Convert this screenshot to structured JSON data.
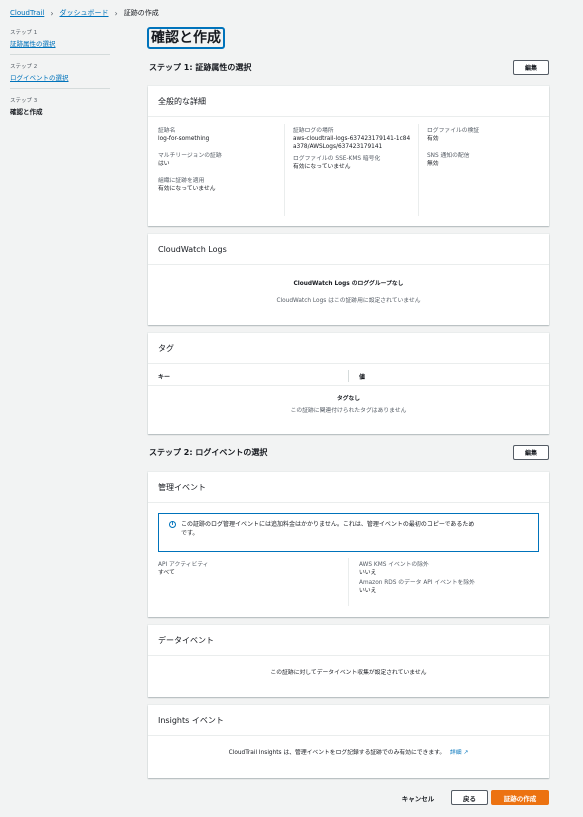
{
  "breadcrumb": {
    "items": [
      "CloudTrail",
      "ダッシュボード"
    ],
    "current": "証跡の作成"
  },
  "nav": {
    "step1_num": "ステップ 1",
    "step1_label": "証跡属性の選択",
    "step2_num": "ステップ 2",
    "step2_label": "ログイベントの選択",
    "step3_num": "ステップ 3",
    "step3_label": "確認と作成"
  },
  "page_title": "確認と作成",
  "step1": {
    "heading": "ステップ 1: 証跡属性の選択",
    "edit": "編集"
  },
  "general": {
    "title": "全般的な詳細",
    "trail_name_label": "証跡名",
    "trail_name": "log-for-something",
    "multi_region_label": "マルチリージョンの証跡",
    "multi_region": "はい",
    "org_label": "組織に証跡を適用",
    "org": "有効になっていません",
    "log_location_label": "証跡ログの場所",
    "log_location": "aws-cloudtrail-logs-637423179141-1c84a378/AWSLogs/637423179141",
    "kms_label": "ログファイルの SSE-KMS 暗号化",
    "kms": "有効になっていません",
    "validation_label": "ログファイルの検証",
    "validation": "有効",
    "sns_label": "SNS 通知の配信",
    "sns": "無効"
  },
  "cloudwatch": {
    "title": "CloudWatch Logs",
    "empty_title": "CloudWatch Logs のロググループなし",
    "empty_desc": "CloudWatch Logs はこの証跡用に設定されていません"
  },
  "tags": {
    "title": "タグ",
    "col_key": "キー",
    "col_value": "値",
    "empty_title": "タグなし",
    "empty_desc": "この証跡に関連付けられたタグはありません"
  },
  "step2": {
    "heading": "ステップ 2: ログイベントの選択",
    "edit": "編集"
  },
  "management": {
    "title": "管理イベント",
    "info_line1": "この証跡のログ管理イベントには追加料金はかかりません。これは、管理イベントの最初のコピーであるため",
    "info_line2": "です。",
    "api_label": "API アクティビティ",
    "api": "すべて",
    "kms_exclude_label": "AWS KMS イベントの除外",
    "kms_exclude": "いいえ",
    "rds_exclude_label": "Amazon RDS のデータ API イベントを除外",
    "rds_exclude": "いいえ"
  },
  "data_events": {
    "title": "データイベント",
    "empty": "この証跡に対してデータイベント収集が設定されていません"
  },
  "insights": {
    "title": "Insights イベント",
    "desc": "CloudTrail Insights は、管理イベントをログ記録する証跡でのみ有効にできます。",
    "link": "詳細"
  },
  "footer": {
    "cancel": "キャンセル",
    "back": "戻る",
    "create": "証跡の作成"
  },
  "colors": {
    "accent": "#0073bb",
    "primary": "#ec7211"
  }
}
